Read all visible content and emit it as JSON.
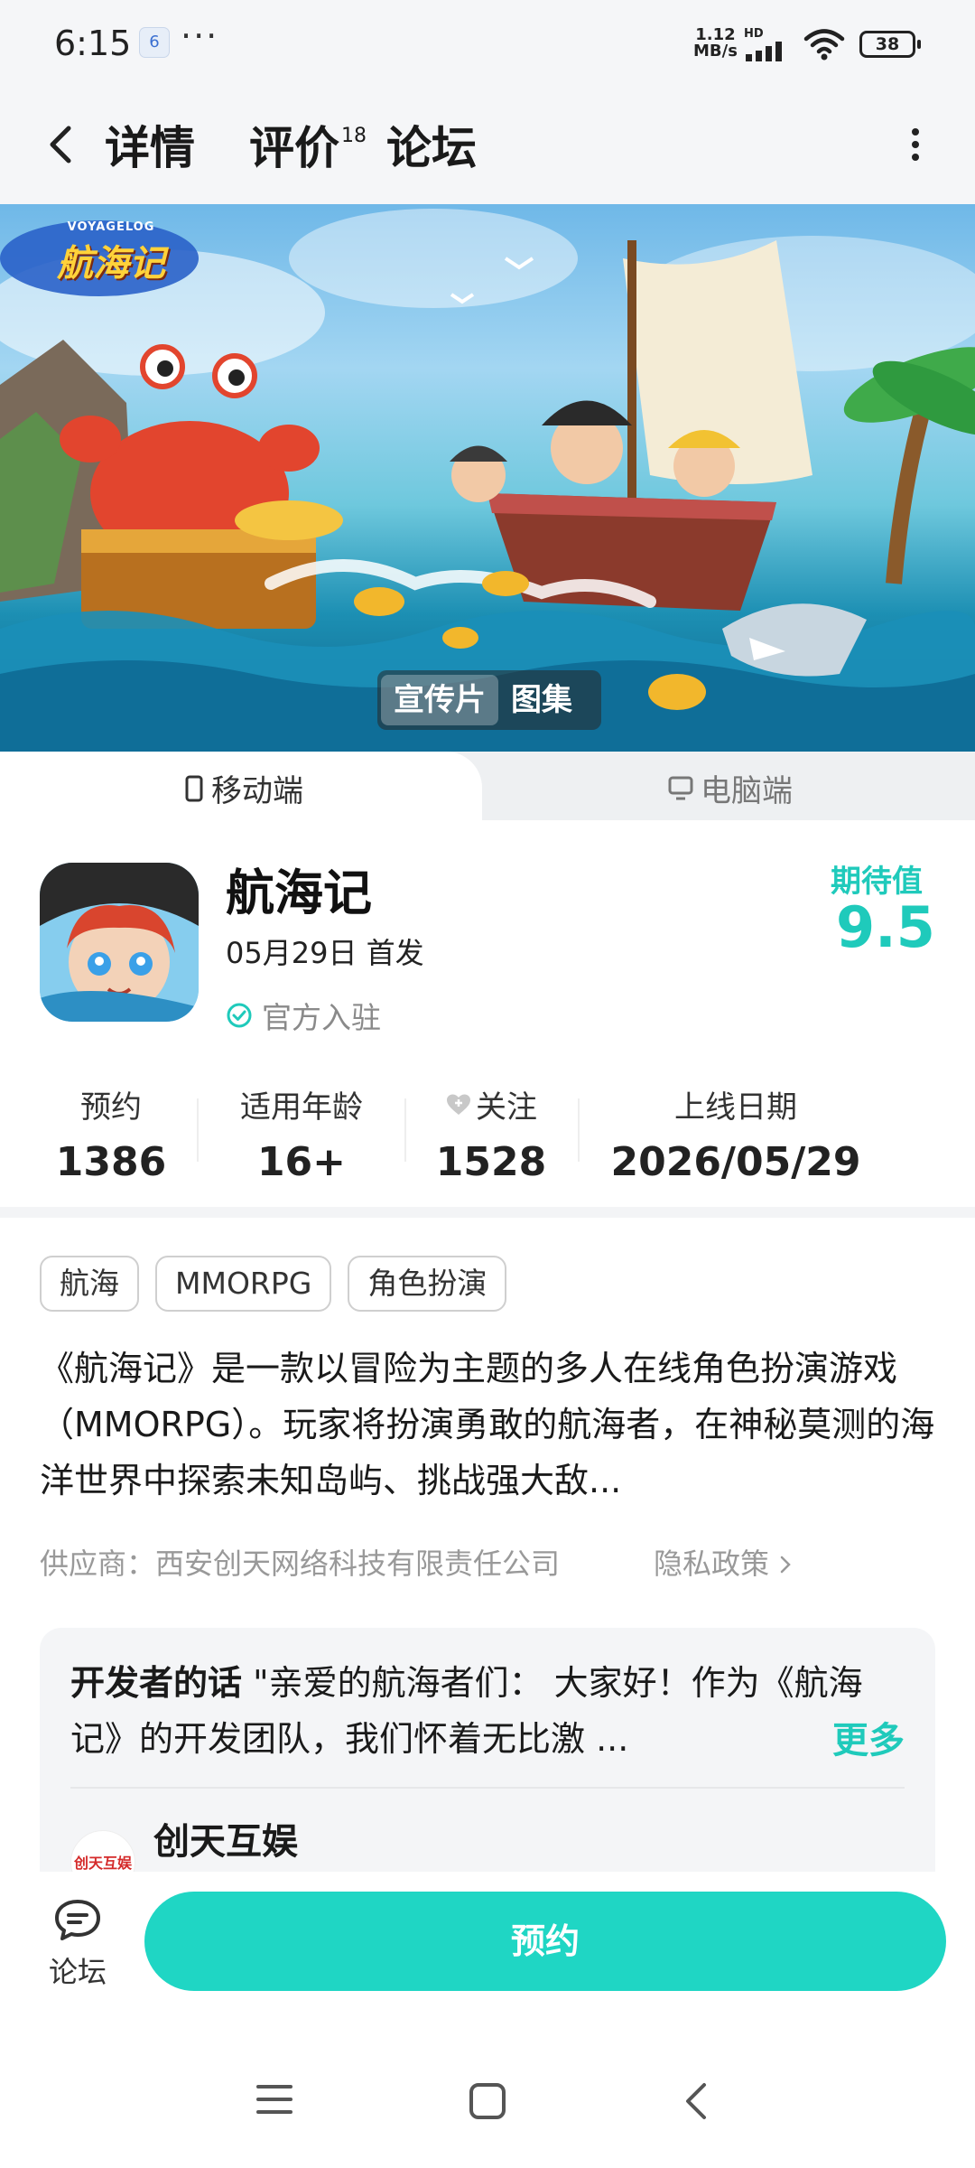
{
  "status_bar": {
    "time": "6:15",
    "net_speed_value": "1.12",
    "net_speed_unit": "MB/s",
    "network_type": "HD",
    "battery": "38",
    "app_icon_text": "6"
  },
  "header": {
    "tabs": [
      {
        "label": "详情",
        "active": true
      },
      {
        "label": "评价",
        "badge": "18"
      },
      {
        "label": "论坛"
      }
    ]
  },
  "banner": {
    "logo_text": "航海记",
    "logo_subtext": "VOYAGELOG",
    "switch": [
      {
        "label": "宣传片",
        "active": true
      },
      {
        "label": "图集",
        "active": false
      }
    ]
  },
  "platform_tabs": [
    {
      "label": "移动端",
      "active": true,
      "icon": "phone-icon"
    },
    {
      "label": "电脑端",
      "active": false,
      "icon": "monitor-icon"
    }
  ],
  "app": {
    "name": "航海记",
    "release": "05月29日 首发",
    "official": "官方入驻",
    "expect_label": "期待值",
    "expect_value": "9.5"
  },
  "stats": [
    {
      "label": "预约",
      "value": "1386"
    },
    {
      "label": "适用年龄",
      "value": "16+"
    },
    {
      "label": "关注",
      "value": "1528",
      "icon": "heart-plus-icon"
    },
    {
      "label": "上线日期",
      "value": "2026/05/29"
    }
  ],
  "tags": [
    "航海",
    "MMORPG",
    "角色扮演"
  ],
  "description": "《航海记》是一款以冒险为主题的多人在线角色扮演游戏（MMORPG）。玩家将扮演勇敢的航海者，在神秘莫测的海洋世界中探索未知岛屿、挑战强大敌...",
  "supplier": "供应商：西安创天网络科技有限责任公司",
  "privacy": "隐私政策",
  "developer": {
    "lead": "开发者的话",
    "text": "\"亲爱的航海者们： 大家好！作为《航海记》的开发团队，我们怀着无比激 ...",
    "more": "更多",
    "name": "创天互娱",
    "avatar_text": "创天互娱"
  },
  "bottom": {
    "forum_label": "论坛",
    "reserve_label": "预约"
  },
  "colors": {
    "accent": "#1fd1c1",
    "reserve_button": "#1fd6c4",
    "expect": "#1fcabb"
  }
}
